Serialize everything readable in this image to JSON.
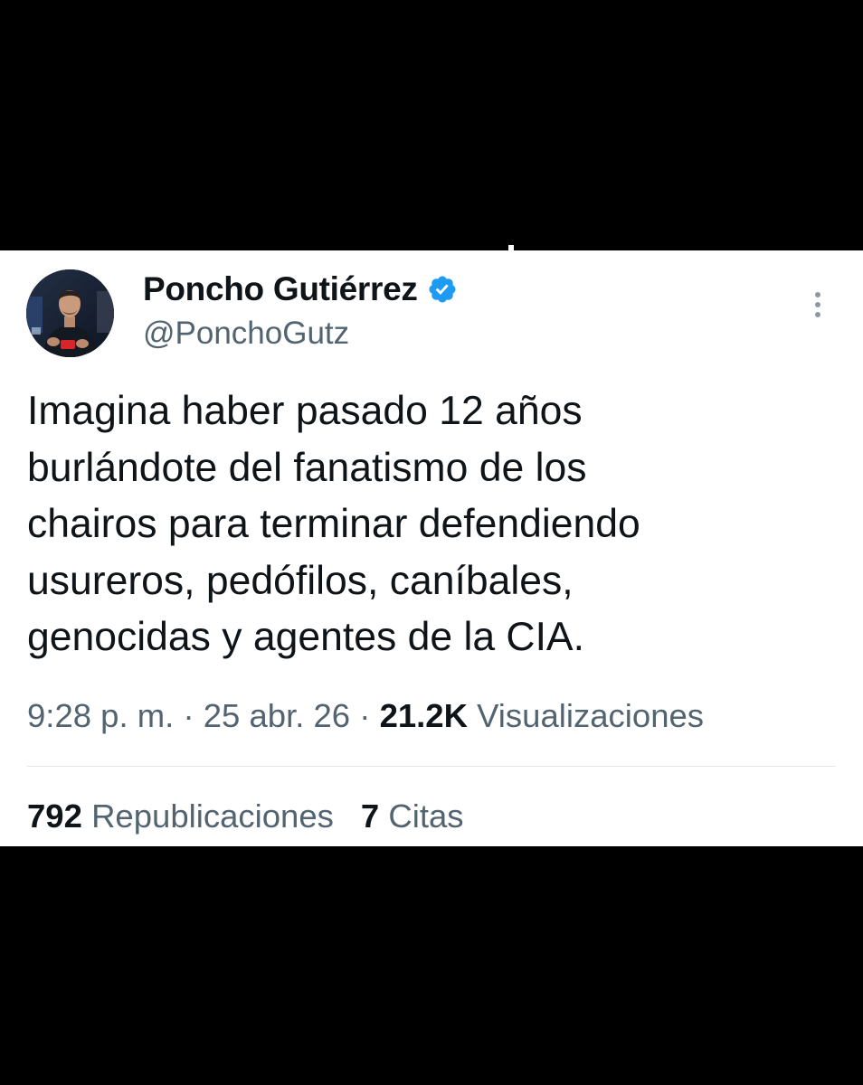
{
  "colors": {
    "background_frame": "#000000",
    "card_background": "#ffffff",
    "primary_text": "#0f1419",
    "secondary_text": "#536471",
    "verified_blue": "#1d9bf0",
    "divider": "#e3e8ec"
  },
  "author": {
    "display_name": "Poncho Gutiérrez",
    "handle": "@PonchoGutz",
    "verified_icon": "verified-badge-icon",
    "avatar_icon": "avatar-photo"
  },
  "more_icon": "more-options-icon",
  "tweet": {
    "text": "Imagina haber pasado 12 años\nburlándote del fanatismo de los\nchairos para terminar defendiendo\nusureros, pedófilos, caníbales,\ngenocidas y agentes de la CIA."
  },
  "meta": {
    "time": "9:28 p. m.",
    "separator": " · ",
    "date": "25 abr. 26",
    "views_count": "21.2K",
    "views_label": "Visualizaciones"
  },
  "stats": {
    "reposts_count": "792",
    "reposts_label": "Republicaciones",
    "quotes_count": "7",
    "quotes_label": "Citas"
  }
}
